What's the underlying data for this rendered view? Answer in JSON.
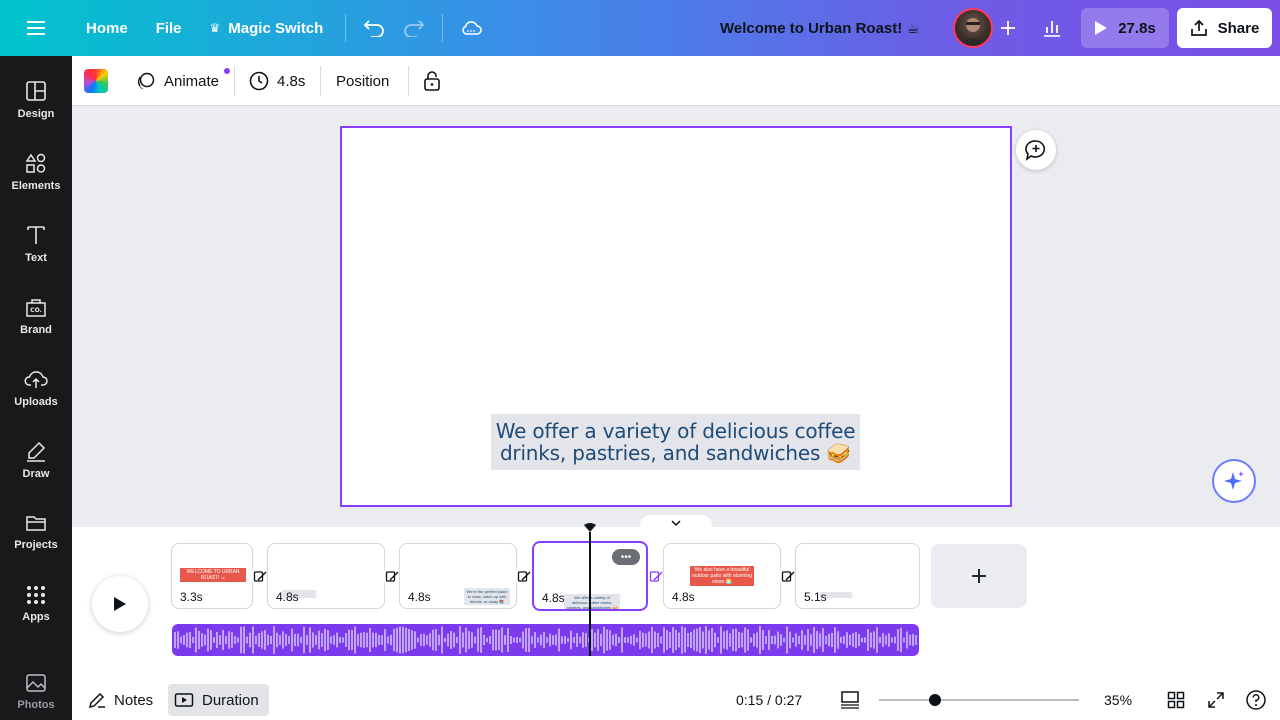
{
  "topbar": {
    "home": "Home",
    "file": "File",
    "magic_switch": "Magic Switch",
    "title": "Welcome to Urban Roast! ☕",
    "present_duration": "27.8s",
    "share": "Share"
  },
  "sidebar": {
    "items": [
      {
        "label": "Design",
        "icon": "layout-icon"
      },
      {
        "label": "Elements",
        "icon": "shapes-icon"
      },
      {
        "label": "Text",
        "icon": "text-icon"
      },
      {
        "label": "Brand",
        "icon": "brand-icon"
      },
      {
        "label": "Uploads",
        "icon": "cloud-upload-icon"
      },
      {
        "label": "Draw",
        "icon": "pen-icon"
      },
      {
        "label": "Projects",
        "icon": "folder-icon"
      },
      {
        "label": "Apps",
        "icon": "grid-icon"
      },
      {
        "label": "Photos",
        "icon": "image-icon"
      }
    ]
  },
  "toolbar": {
    "animate": "Animate",
    "duration": "4.8s",
    "position": "Position"
  },
  "canvas": {
    "caption_line1": "We offer a variety of delicious coffee",
    "caption_line2": "drinks, pastries, and sandwiches 🥪"
  },
  "timeline": {
    "clips": [
      {
        "duration": "3.3s",
        "thumb": "WELCOME TO URBAN ROAST! ☕"
      },
      {
        "duration": "4.8s",
        "thumb": ""
      },
      {
        "duration": "4.8s",
        "thumb": "We're the perfect place to relax, catch up with friends, or study 📚"
      },
      {
        "duration": "4.8s",
        "thumb": "We offer a variety of delicious coffee drinks, pastries, and sandwiches 🥪"
      },
      {
        "duration": "4.8s",
        "thumb": "We also have a beautiful outdoor patio with stunning views 🌅"
      },
      {
        "duration": "5.1s",
        "thumb": ""
      }
    ]
  },
  "bottombar": {
    "notes": "Notes",
    "duration": "Duration",
    "time": "0:15 / 0:27",
    "zoom": "35%",
    "zoom_level": 0.28
  },
  "colors": {
    "accent": "#8b3dff",
    "sidebar_bg": "#18191b",
    "audio": "#7c3aed",
    "caption_text": "#1f4b78"
  }
}
